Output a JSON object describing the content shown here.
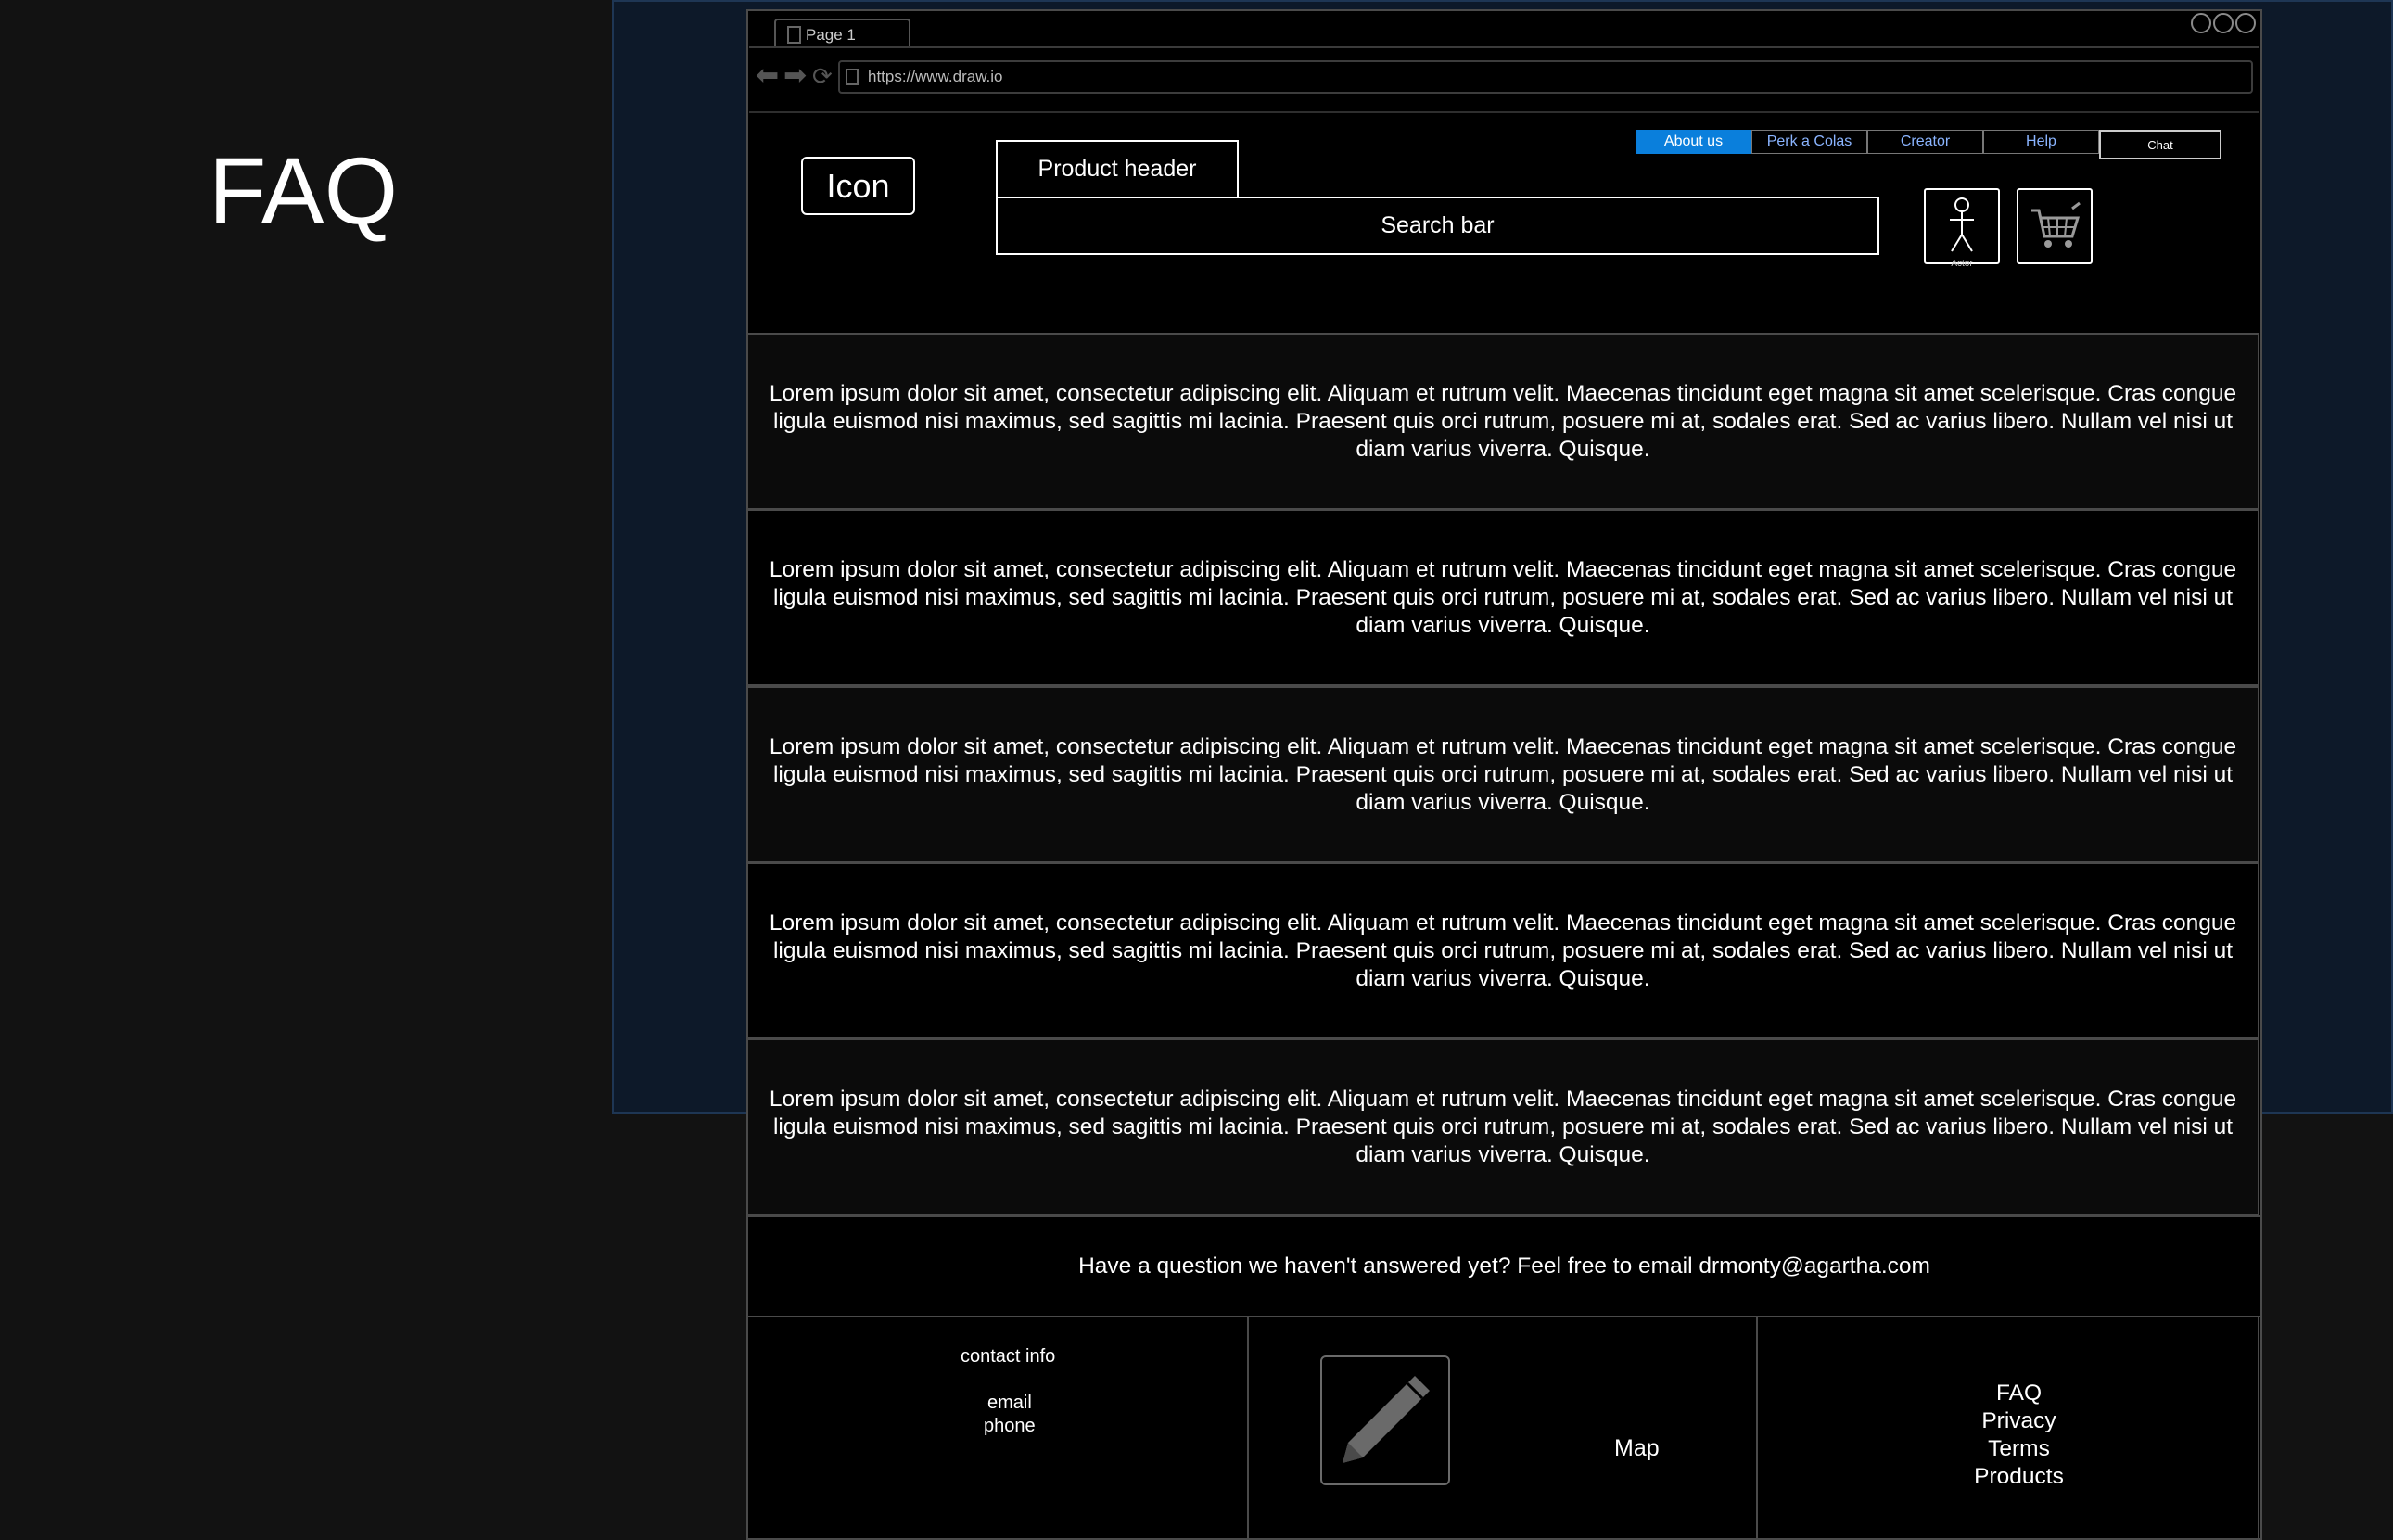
{
  "page": {
    "title": "FAQ"
  },
  "browser": {
    "tab_label": "Page 1",
    "url": "https://www.draw.io"
  },
  "header": {
    "icon_label": "Icon",
    "product_header": "Product header",
    "search_bar": "Search bar",
    "menu": [
      "About us",
      "Perk a Colas",
      "Creator",
      "Help",
      "Chat"
    ],
    "actor_label": "Actor"
  },
  "faq": {
    "items": [
      "Lorem ipsum dolor sit amet, consectetur adipiscing elit. Aliquam et rutrum velit. Maecenas tincidunt eget magna sit amet scelerisque. Cras congue ligula euismod nisi maximus, sed sagittis mi lacinia. Praesent quis orci rutrum, posuere mi at, sodales erat. Sed ac varius libero. Nullam vel nisi ut diam varius viverra. Quisque.",
      "Lorem ipsum dolor sit amet, consectetur adipiscing elit. Aliquam et rutrum velit. Maecenas tincidunt eget magna sit amet scelerisque. Cras congue ligula euismod nisi maximus, sed sagittis mi lacinia. Praesent quis orci rutrum, posuere mi at, sodales erat. Sed ac varius libero. Nullam vel nisi ut diam varius viverra. Quisque.",
      "Lorem ipsum dolor sit amet, consectetur adipiscing elit. Aliquam et rutrum velit. Maecenas tincidunt eget magna sit amet scelerisque. Cras congue ligula euismod nisi maximus, sed sagittis mi lacinia. Praesent quis orci rutrum, posuere mi at, sodales erat. Sed ac varius libero. Nullam vel nisi ut diam varius viverra. Quisque.",
      "Lorem ipsum dolor sit amet, consectetur adipiscing elit. Aliquam et rutrum velit. Maecenas tincidunt eget magna sit amet scelerisque. Cras congue ligula euismod nisi maximus, sed sagittis mi lacinia. Praesent quis orci rutrum, posuere mi at, sodales erat. Sed ac varius libero. Nullam vel nisi ut diam varius viverra. Quisque.",
      "Lorem ipsum dolor sit amet, consectetur adipiscing elit. Aliquam et rutrum velit. Maecenas tincidunt eget magna sit amet scelerisque. Cras congue ligula euismod nisi maximus, sed sagittis mi lacinia. Praesent quis orci rutrum, posuere mi at, sodales erat. Sed ac varius libero. Nullam vel nisi ut diam varius viverra. Quisque."
    ],
    "question_text": "Have a question we haven't answered yet? Feel free to email drmonty@agartha.com"
  },
  "footer": {
    "contact_title": "contact info",
    "contact_email": "email",
    "contact_phone": "phone",
    "map_label": "Map",
    "links": [
      "FAQ",
      "Privacy",
      "Terms",
      "Products"
    ]
  },
  "colors": {
    "background": "#121212",
    "panel": "#0d1929",
    "accent": "#0a7fdc",
    "link": "#8ab4ff"
  },
  "icons": [
    "page-icon",
    "back-arrow-icon",
    "forward-arrow-icon",
    "reload-icon",
    "actor-icon",
    "shopping-cart-icon",
    "pencil-icon"
  ]
}
